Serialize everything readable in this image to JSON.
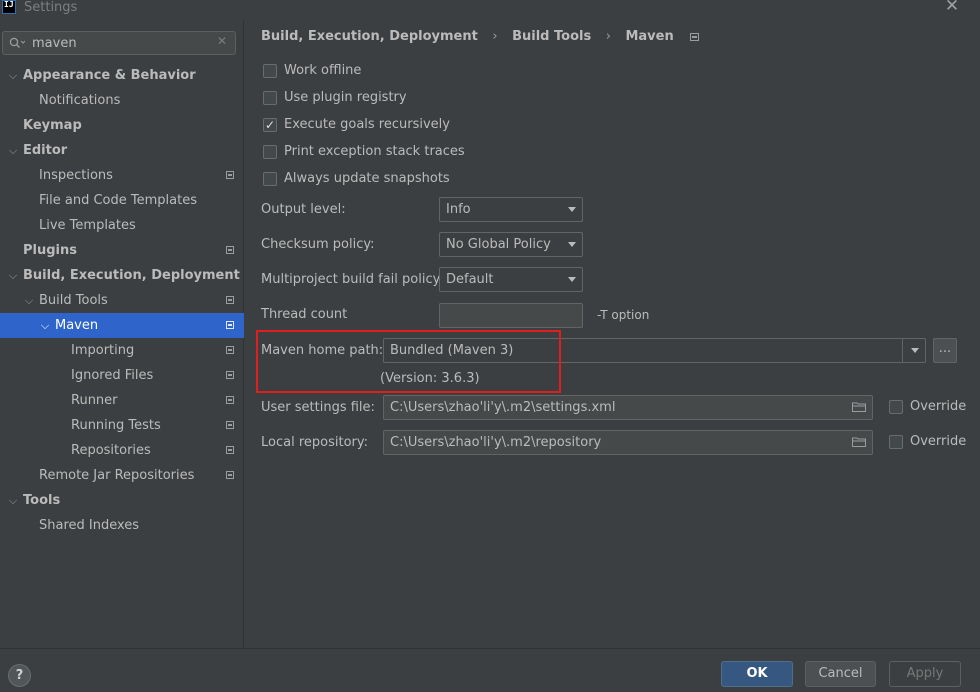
{
  "window": {
    "title": "Settings",
    "logo_text": "IJ",
    "close_glyph": "✕"
  },
  "search": {
    "value": "maven",
    "clear_glyph": "✕"
  },
  "sidebar": {
    "items": [
      {
        "label": "Appearance & Behavior",
        "arrow": "⌵"
      },
      {
        "label": "Notifications"
      },
      {
        "label": "Keymap"
      },
      {
        "label": "Editor",
        "arrow": "⌵"
      },
      {
        "label": "Inspections"
      },
      {
        "label": "File and Code Templates"
      },
      {
        "label": "Live Templates"
      },
      {
        "label": "Plugins"
      },
      {
        "label": "Build, Execution, Deployment",
        "arrow": "⌵"
      },
      {
        "label": "Build Tools",
        "arrow": "⌵"
      },
      {
        "label": "Maven",
        "arrow": "⌵"
      },
      {
        "label": "Importing"
      },
      {
        "label": "Ignored Files"
      },
      {
        "label": "Runner"
      },
      {
        "label": "Running Tests"
      },
      {
        "label": "Repositories"
      },
      {
        "label": "Remote Jar Repositories"
      },
      {
        "label": "Tools",
        "arrow": "⌵"
      },
      {
        "label": "Shared Indexes"
      }
    ]
  },
  "breadcrumb": {
    "items": [
      "Build, Execution, Deployment",
      "Build Tools",
      "Maven"
    ],
    "separator": "›"
  },
  "checkboxes": [
    {
      "label": "Work offline",
      "checked": false
    },
    {
      "label": "Use plugin registry",
      "checked": false
    },
    {
      "label": "Execute goals recursively",
      "checked": true
    },
    {
      "label": "Print exception stack traces",
      "checked": false
    },
    {
      "label": "Always update snapshots",
      "checked": false
    }
  ],
  "form": {
    "output_level": {
      "label": "Output level:",
      "value": "Info"
    },
    "checksum_policy": {
      "label": "Checksum policy:",
      "value": "No Global Policy"
    },
    "multiproject": {
      "label": "Multiproject build fail policy:",
      "value": "Default"
    },
    "thread_count": {
      "label": "Thread count",
      "value": "",
      "hint": "-T option"
    },
    "maven_home": {
      "label": "Maven home path:",
      "value": "Bundled (Maven 3)",
      "version": "(Version: 3.6.3)",
      "browse_label": "..."
    },
    "user_settings": {
      "label": "User settings file:",
      "value": "C:\\Users\\zhao'li'y\\.m2\\settings.xml",
      "override_label": "Override"
    },
    "local_repo": {
      "label": "Local repository:",
      "value": "C:\\Users\\zhao'li'y\\.m2\\repository",
      "override_label": "Override"
    }
  },
  "footer": {
    "help": "?",
    "ok": "OK",
    "cancel": "Cancel",
    "apply": "Apply"
  },
  "colors": {
    "accent": "#2f65ca",
    "highlight": "#e01e1e",
    "ok_button": "#365880",
    "background": "#3c3f41"
  }
}
